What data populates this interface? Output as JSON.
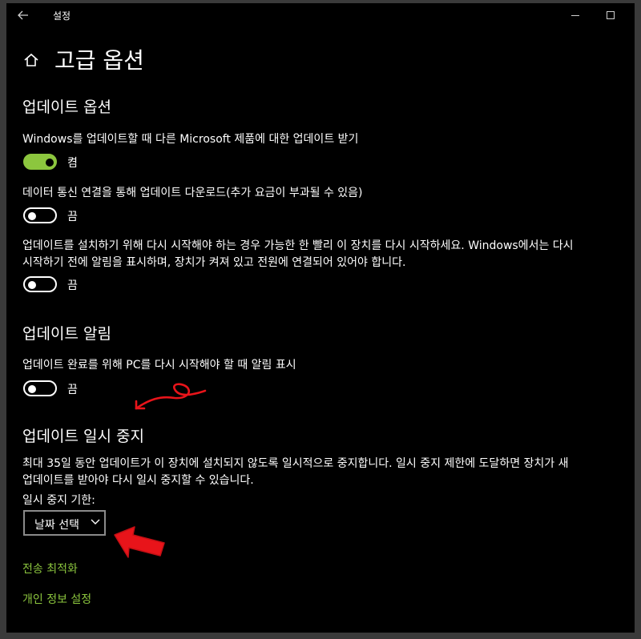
{
  "window": {
    "title": "설정"
  },
  "page": {
    "title": "고급 옵션"
  },
  "update_options": {
    "heading": "업데이트 옵션",
    "items": [
      {
        "label": "Windows를 업데이트할 때 다른 Microsoft 제품에 대한 업데이트 받기",
        "state": "켬"
      },
      {
        "label": "데이터 통신 연결을 통해 업데이트 다운로드(추가 요금이 부과될 수 있음)",
        "state": "끔"
      },
      {
        "label_line1": "업데이트를 설치하기 위해 다시 시작해야 하는 경우 가능한 한 빨리 이 장치를 다시 시작하세요. Windows에서는 다시",
        "label_line2": "시작하기 전에 알림을 표시하며, 장치가 켜져 있고 전원에 연결되어 있어야 합니다.",
        "state": "끔"
      }
    ]
  },
  "update_notifications": {
    "heading": "업데이트 알림",
    "label": "업데이트 완료를 위해 PC를 다시 시작해야 할 때 알림 표시",
    "state": "끔"
  },
  "pause_updates": {
    "heading": "업데이트 일시 중지",
    "description_line1": "최대 35일 동안 업데이트가 이 장치에 설치되지 않도록 일시적으로 중지합니다. 일시 중지 제한에 도달하면 장치가 새",
    "description_line2": "업데이트를 받아야 다시 일시 중지할 수 있습니다.",
    "until_label": "일시 중지 기한:",
    "dropdown_value": "날짜 선택"
  },
  "links": {
    "delivery_optimization": "전송 최적화",
    "privacy_settings": "개인 정보 설정"
  },
  "colors": {
    "background": "#000000",
    "accent": "#8cc63e",
    "annotation": "#e8141a"
  },
  "icons": {
    "back": "back-arrow-icon",
    "home": "home-icon",
    "chevron": "chevron-down-icon"
  }
}
